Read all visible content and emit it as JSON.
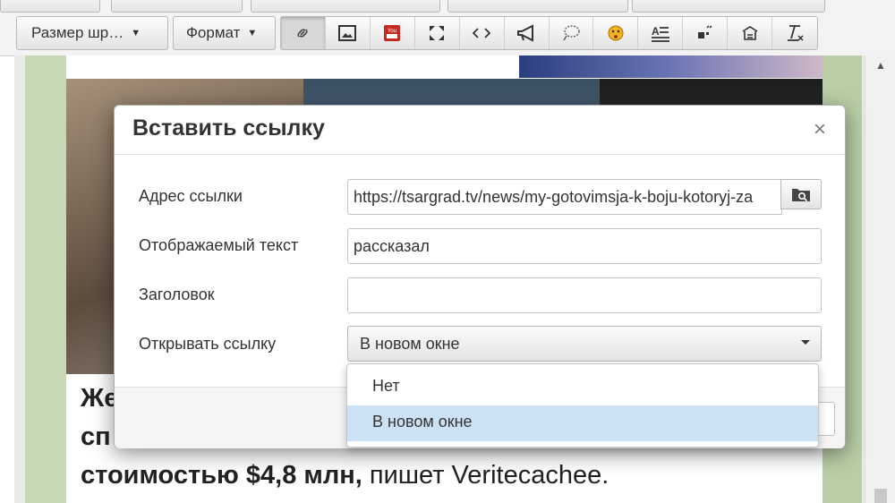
{
  "toolbar": {
    "font_size_label": "Размер шр…",
    "format_label": "Формат",
    "icons": [
      "link-icon",
      "image-icon",
      "youtube-icon",
      "fullscreen-icon",
      "source-code-icon",
      "megaphone-icon",
      "lasso-icon",
      "emoji-icon",
      "text-format-icon",
      "quote-icon",
      "template-icon",
      "clear-format-icon"
    ]
  },
  "editor": {
    "article_bold": "стоимостью $4,8 млн,",
    "article_rest": " пишет Veritecachee.",
    "line1_fragment": "Же",
    "line2_fragment": "сп"
  },
  "dialog": {
    "title": "Вставить ссылку",
    "close_symbol": "×",
    "url_label": "Адрес ссылки",
    "url_value": "https://tsargrad.tv/news/my-gotovimsja-k-boju-kotoryj-za",
    "text_label": "Отображаемый текст",
    "text_value": "рассказал",
    "title_label": "Заголовок",
    "title_value": "",
    "target_label": "Открывать ссылку",
    "target_value": "В новом окне",
    "target_options": [
      "Нет",
      "В новом окне"
    ],
    "selected_option": "В новом окне"
  }
}
